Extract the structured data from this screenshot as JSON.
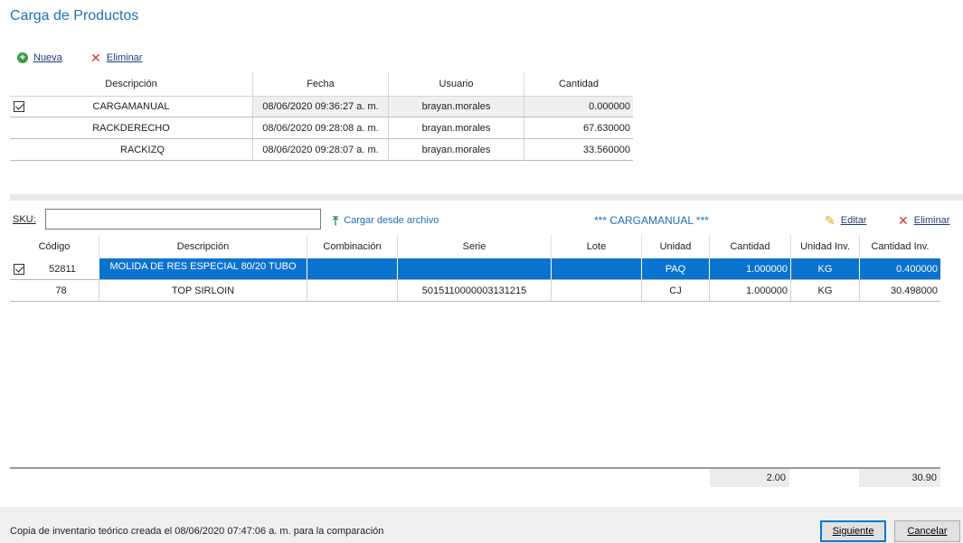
{
  "title": "Carga de Productos",
  "toolbar1": {
    "new_label": "Nueva",
    "delete_label": "Eliminar"
  },
  "loads_table": {
    "columns": [
      "Descripción",
      "Fecha",
      "Usuario",
      "Cantidad"
    ],
    "rows": [
      {
        "checked": true,
        "descripcion": "CARGAMANUAL",
        "fecha": "08/06/2020 09:36:27 a. m.",
        "usuario": "brayan.morales",
        "cantidad": "0.000000"
      },
      {
        "checked": false,
        "descripcion": "RACKDERECHO",
        "fecha": "08/06/2020 09:28:08 a. m.",
        "usuario": "brayan.morales",
        "cantidad": "67.630000"
      },
      {
        "checked": false,
        "descripcion": "RACKIZQ",
        "fecha": "08/06/2020 09:28:07 a. m.",
        "usuario": "brayan.morales",
        "cantidad": "33.560000"
      }
    ]
  },
  "sku": {
    "label": "SKU:",
    "value": ""
  },
  "toolbar2": {
    "load_file_label": "Cargar desde archivo",
    "current_load": "*** CARGAMANUAL ***",
    "edit_label": "Editar",
    "delete_label": "Eliminar"
  },
  "products_table": {
    "columns": [
      "Código",
      "Descripción",
      "Combinación",
      "Serie",
      "Lote",
      "Unidad",
      "Cantidad",
      "Unidad Inv.",
      "Cantidad Inv."
    ],
    "rows": [
      {
        "checked": true,
        "codigo": "52811",
        "descripcion": "MOLIDA DE RES ESPECIAL 80/20 TUBO",
        "combinacion": "",
        "serie": "",
        "lote": "",
        "unidad": "PAQ",
        "cantidad": "1.000000",
        "unidad_inv": "KG",
        "cantidad_inv": "0.400000"
      },
      {
        "checked": false,
        "codigo": "78",
        "descripcion": "TOP SIRLOIN",
        "combinacion": "",
        "serie": "5015110000003131215",
        "lote": "",
        "unidad": "CJ",
        "cantidad": "1.000000",
        "unidad_inv": "KG",
        "cantidad_inv": "30.498000"
      }
    ]
  },
  "totals": {
    "cantidad": "2.00",
    "cantidad_inv": "30.90"
  },
  "status": "Copia de inventario teórico creada el 08/06/2020 07:47:06 a. m. para la comparación",
  "buttons": {
    "next": "Siguiente",
    "cancel": "Cancelar"
  },
  "colors": {
    "title": "#1f6fb5",
    "selection": "#0a73d0",
    "add": "#3f9a45",
    "delete": "#d9322b"
  },
  "icons": {
    "new": "plus-circle-icon",
    "delete": "x-icon",
    "upload": "upload-icon",
    "edit": "pencil-icon",
    "check": "checkbox-icon"
  }
}
